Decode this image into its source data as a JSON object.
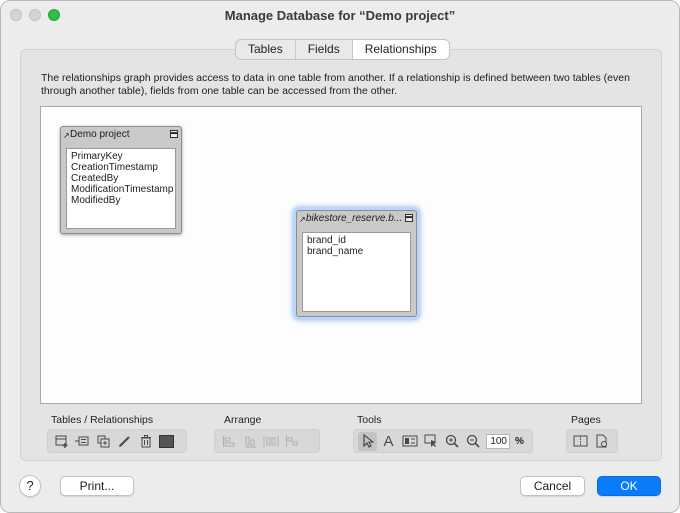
{
  "window": {
    "title": "Manage Database for “Demo project”"
  },
  "tabs": [
    {
      "label": "Tables",
      "active": false
    },
    {
      "label": "Fields",
      "active": false
    },
    {
      "label": "Relationships",
      "active": true
    }
  ],
  "description": "The relationships graph provides access to data in one table from another. If a relationship is defined between two tables (even through another table), fields from one table can be accessed from the other.",
  "graph": {
    "tables": [
      {
        "name": "Demo project",
        "fields": [
          "PrimaryKey",
          "CreationTimestamp",
          "CreatedBy",
          "ModificationTimestamp",
          "ModifiedBy"
        ],
        "selected": false
      },
      {
        "name": "bikestore_reserve.b...",
        "fields": [
          "brand_id",
          "brand_name"
        ],
        "selected": true
      }
    ]
  },
  "toolbar": {
    "tables_relationships_label": "Tables / Relationships",
    "arrange_label": "Arrange",
    "tools_label": "Tools",
    "pages_label": "Pages",
    "zoom_value": "100",
    "zoom_unit": "%",
    "icons": {
      "tables": [
        "add-table-icon",
        "add-relationship-icon",
        "duplicate-icon",
        "edit-pencil-icon",
        "trash-icon",
        "color-swatch-icon"
      ],
      "arrange": [
        "align-left-icon",
        "align-center-icon",
        "distribute-horizontal-icon",
        "distribute-vertical-icon"
      ],
      "tools": [
        "pointer-icon",
        "text-tool-icon",
        "show-hide-icon",
        "select-related-icon",
        "zoom-in-icon",
        "zoom-out-icon"
      ],
      "pages": [
        "page-break-icon",
        "page-setup-icon"
      ]
    }
  },
  "footer": {
    "help_label": "?",
    "print_label": "Print...",
    "cancel_label": "Cancel",
    "ok_label": "OK"
  },
  "colors": {
    "accent": "#0a7cf9",
    "selection_glow": "#8fb6f3"
  }
}
